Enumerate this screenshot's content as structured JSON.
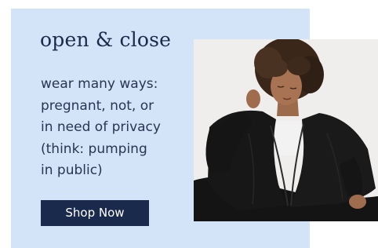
{
  "promo": {
    "title": "open & close",
    "body_lines": [
      "wear many ways:",
      "pregnant, not, or",
      "in need of privacy",
      "(think: pumping",
      "in public)"
    ],
    "cta_label": "Shop Now"
  },
  "colors": {
    "panel_background": "#d3e3f8",
    "title_text": "#1c2a4a",
    "body_text": "#2a3552",
    "button_background": "#1a2a4c",
    "button_text": "#ffffff",
    "garment": "#161616"
  }
}
